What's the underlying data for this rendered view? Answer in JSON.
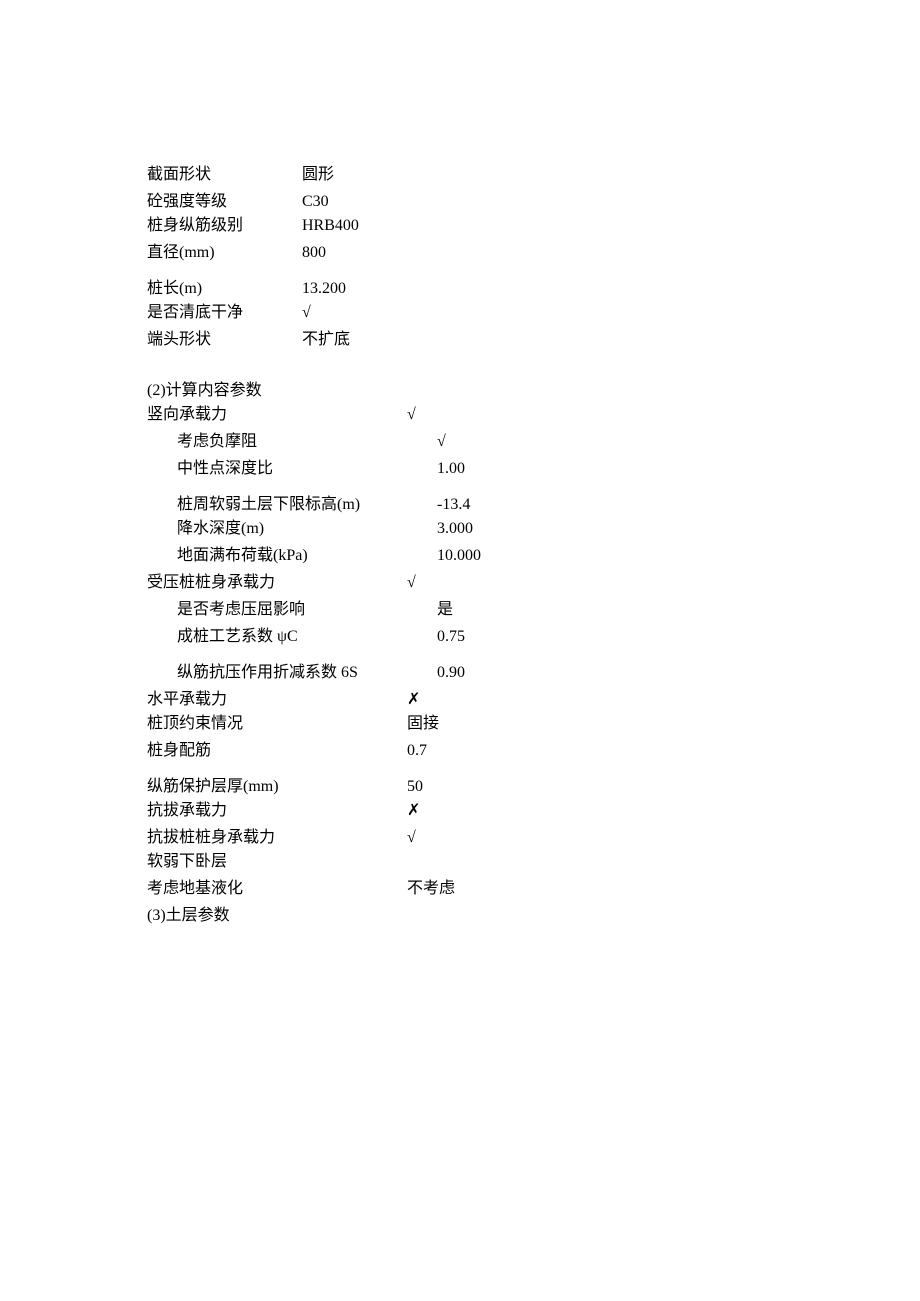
{
  "section1": {
    "shape": {
      "label": "截面形状",
      "value": "圆形"
    },
    "concreteGrade": {
      "label": "砼强度等级",
      "value": "C30"
    },
    "rebarGrade": {
      "label": "桩身纵筋级别",
      "value": "HRB400"
    },
    "diameter": {
      "label": "直径(mm)",
      "value": "800"
    },
    "length": {
      "label": "桩长(m)",
      "value": "13.200"
    },
    "cleanBottom": {
      "label": "是否清底干净",
      "value": "√"
    },
    "endShape": {
      "label": "端头形状",
      "value": "不扩底"
    }
  },
  "section2header": "(2)计算内容参数",
  "section2": {
    "verticalBearing": {
      "label": "竖向承载力",
      "value": "√"
    },
    "negFriction": {
      "label": "考虑负摩阻",
      "value": "√"
    },
    "neutralRatio": {
      "label": "中性点深度比",
      "value": "1.00"
    },
    "softLimit": {
      "label": "桩周软弱土层下限标高(m)",
      "value": "-13.4"
    },
    "dewater": {
      "label": "降水深度(m)",
      "value": "3.000"
    },
    "surfaceLoad": {
      "label": "地面满布荷载(kPa)",
      "value": "10.000"
    },
    "compPileBody": {
      "label": "受压桩桩身承载力",
      "value": "√"
    },
    "buckling": {
      "label": "是否考虑压屈影响",
      "value": "是"
    },
    "processC": {
      "label": "成桩工艺系数 ψC",
      "value": "0.75"
    },
    "rebarReduce": {
      "label": "纵筋抗压作用折减系数 6S",
      "value": "0.90"
    },
    "horizBearing": {
      "label": "水平承载力",
      "value": "✗"
    },
    "topConstraint": {
      "label": "桩顶约束情况",
      "value": "固接"
    },
    "bodyRebar": {
      "label": "桩身配筋",
      "value": "0.7"
    },
    "cover": {
      "label": "纵筋保护层厚(mm)",
      "value": "50"
    },
    "upliftBearing": {
      "label": "抗拔承载力",
      "value": "✗"
    },
    "upliftBody": {
      "label": "抗拔桩桩身承载力",
      "value": "√"
    },
    "softUnderlay": {
      "label": "软弱下卧层",
      "value": ""
    },
    "liquefaction": {
      "label": "考虑地基液化",
      "value": "不考虑"
    }
  },
  "section3header": "(3)土层参数"
}
